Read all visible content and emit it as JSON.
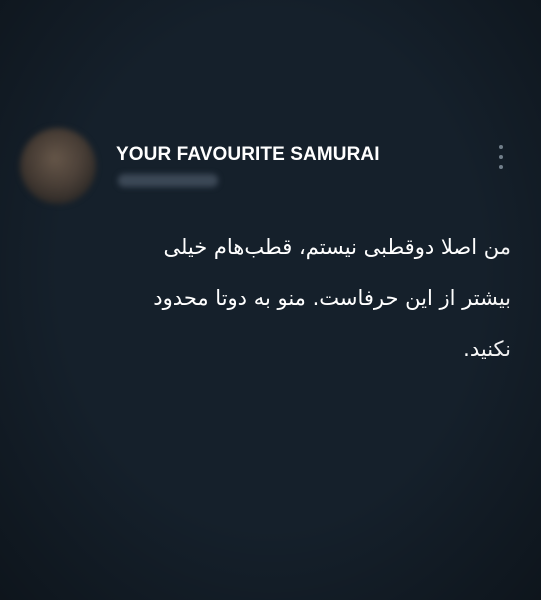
{
  "tweet": {
    "display_name": "YOUR FAVOURITE SAMURAI",
    "text": "من اصلا دوقطبی نیستم، قطب‌هام خیلی\nبیشتر از این حرفاست. منو به دوتا محدود\nنکنید."
  },
  "icons": {
    "more": "more-vertical-icon"
  },
  "colors": {
    "background": "#15202b",
    "text": "#ffffff",
    "icon": "#7a8895"
  }
}
